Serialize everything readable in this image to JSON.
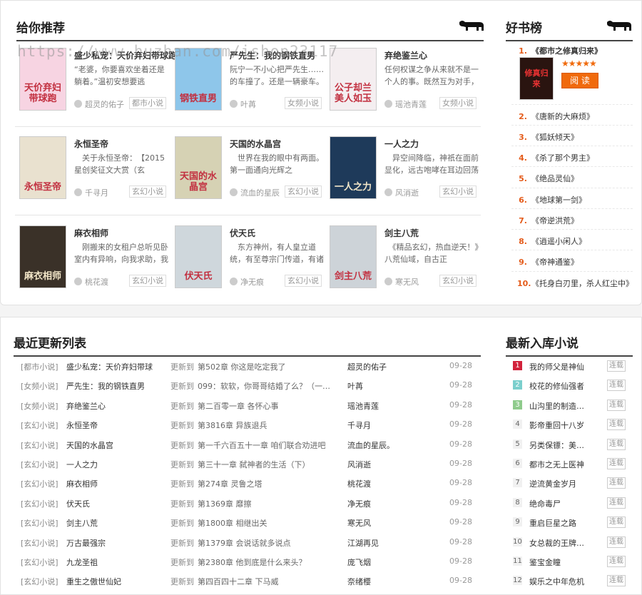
{
  "watermark": "https://www.huzhan.com/ishop23117",
  "recommend": {
    "title": "给你推荐",
    "books": [
      {
        "title": "盛少私宠：天价弃妇带球跑",
        "desc": "“老婆，你要喜欢坐着还是躺着。”温初安想要逃",
        "author": "超灵的佑子",
        "category": "都市小说",
        "cover_text": "天价弃妇带球跑",
        "cover_color": "#f7d4e2"
      },
      {
        "title": "严先生：我的钢铁直男",
        "desc": "阮宁一不小心把严先生……的车撞了。还是一辆豪车。",
        "author": "叶苒",
        "category": "女频小说",
        "cover_text": "钢铁直男",
        "cover_color": "#8ec6ea"
      },
      {
        "title": "弃绝鉴兰心",
        "desc": "任何权谋之争从来就不是一个人的事。既然互为对手，",
        "author": "瑶池青莲",
        "category": "女频小说",
        "cover_text": "公子却兰 美人如玉",
        "cover_color": "#f4eef0"
      },
      {
        "title": "永恒圣帝",
        "desc": "　关于永恒圣帝：　【2015星创奖征文大赏（玄",
        "author": "千寻月",
        "category": "玄幻小说",
        "cover_text": "永恒圣帝",
        "cover_color": "#e9e1cf"
      },
      {
        "title": "天国的水晶宫",
        "desc": "　世界在我的眼中有两面。　第一面通向光辉之",
        "author": "流血的星辰",
        "category": "玄幻小说",
        "cover_text": "天国的水晶宫",
        "cover_color": "#d6d2b4"
      },
      {
        "title": "一人之力",
        "desc": "　异空间降临，神祇在面前显化，远古咆哮在耳边回荡",
        "author": "风消逝",
        "category": "玄幻小说",
        "cover_text": "一人之力",
        "cover_color": "#1e3a5a"
      },
      {
        "title": "麻衣相师",
        "desc": "　刚搬来的女租户总听见卧室内有异响，向我求助，我",
        "author": "桃花渡",
        "category": "玄幻小说",
        "cover_text": "麻衣相师",
        "cover_color": "#3a3128"
      },
      {
        "title": "伏天氏",
        "desc": "　东方神州，有人皇立道统，有至尊宗门传道，有诸",
        "author": "净无痕",
        "category": "玄幻小说",
        "cover_text": "伏天氏",
        "cover_color": "#cfd7dc"
      },
      {
        "title": "剑主八荒",
        "desc": "　《精品玄幻，热血逆天！》　八荒仙域，自古正",
        "author": "寒无风",
        "category": "玄幻小说",
        "cover_text": "剑主八荒",
        "cover_color": "#cdd3d8"
      }
    ]
  },
  "hotlist": {
    "title": "好书榜",
    "items": [
      "《都市之修真归来》",
      "《唐新的大麻烦》",
      "《狐妖倾天》",
      "《杀了那个男主》",
      "《绝品灵仙》",
      "《地球第一剑》",
      "《帝逆洪荒》",
      "《逍遥小闲人》",
      "《帝神通鉴》",
      "《托身白刃里，杀人红尘中》"
    ],
    "ranks": [
      "1.",
      "2.",
      "3.",
      "4.",
      "5.",
      "6.",
      "7.",
      "8.",
      "9.",
      "10."
    ],
    "top_cover_text": "修真归来",
    "stars": "★★★★★",
    "read_label": "阅 读"
  },
  "updates": {
    "title": "最近更新列表",
    "prefix": "更新到",
    "rows": [
      {
        "cat": "[都市小说]",
        "title": "盛少私宠：天价弃妇带球",
        "chapter": "第502章 你这是吃定我了",
        "author": "超灵的佑子",
        "date": "09-28"
      },
      {
        "cat": "[女频小说]",
        "title": "严先生：我的钢铁直男",
        "chapter": "099：软软，你哥哥结婚了么？（一…",
        "author": "叶苒",
        "date": "09-28"
      },
      {
        "cat": "[女频小说]",
        "title": "弃绝鉴兰心",
        "chapter": "第二百零一章 各怀心事",
        "author": "瑶池青莲",
        "date": "09-28"
      },
      {
        "cat": "[玄幻小说]",
        "title": "永恒圣帝",
        "chapter": "第3816章 异族退兵",
        "author": "千寻月",
        "date": "09-28"
      },
      {
        "cat": "[玄幻小说]",
        "title": "天国的水晶宫",
        "chapter": "第一千六百五十一章 咱们联合劝进吧",
        "author": "流血的星辰。",
        "date": "09-28"
      },
      {
        "cat": "[玄幻小说]",
        "title": "一人之力",
        "chapter": "第三十一章 弑神者的生活（下）",
        "author": "风消逝",
        "date": "09-28"
      },
      {
        "cat": "[玄幻小说]",
        "title": "麻衣相师",
        "chapter": "第274章 灵鲁之塔",
        "author": "桃花渡",
        "date": "09-28"
      },
      {
        "cat": "[玄幻小说]",
        "title": "伏天氏",
        "chapter": "第1369章 靡擦",
        "author": "净无痕",
        "date": "09-28"
      },
      {
        "cat": "[玄幻小说]",
        "title": "剑主八荒",
        "chapter": "第1800章 相继出关",
        "author": "寒无风",
        "date": "09-28"
      },
      {
        "cat": "[玄幻小说]",
        "title": "万古最强宗",
        "chapter": "第1379章 会说话就多说点",
        "author": "江湖再见",
        "date": "09-28"
      },
      {
        "cat": "[玄幻小说]",
        "title": "九龙圣祖",
        "chapter": "第2380章 他到底是什么来头？",
        "author": "庞飞烟",
        "date": "09-28"
      },
      {
        "cat": "[玄幻小说]",
        "title": "重生之傲世仙妃",
        "chapter": "第四百四十二章 下马威",
        "author": "奈绪樱",
        "date": "09-28"
      }
    ]
  },
  "newbooks": {
    "title": "最新入库小说",
    "tag": "连载",
    "items": [
      {
        "n": "1",
        "t": "我的师父是神仙"
      },
      {
        "n": "2",
        "t": "校花的修仙强者"
      },
      {
        "n": "3",
        "t": "山沟里的制造…"
      },
      {
        "n": "4",
        "t": "影帝重回十八岁"
      },
      {
        "n": "5",
        "t": "另类保镖：美…"
      },
      {
        "n": "6",
        "t": "都市之无上医神"
      },
      {
        "n": "7",
        "t": "逆流黄金岁月"
      },
      {
        "n": "8",
        "t": "绝命毒尸"
      },
      {
        "n": "9",
        "t": "重启巨星之路"
      },
      {
        "n": "10",
        "t": "女总裁的王牌…"
      },
      {
        "n": "11",
        "t": "鉴宝金瞳"
      },
      {
        "n": "12",
        "t": "娱乐之中年危机"
      }
    ]
  }
}
